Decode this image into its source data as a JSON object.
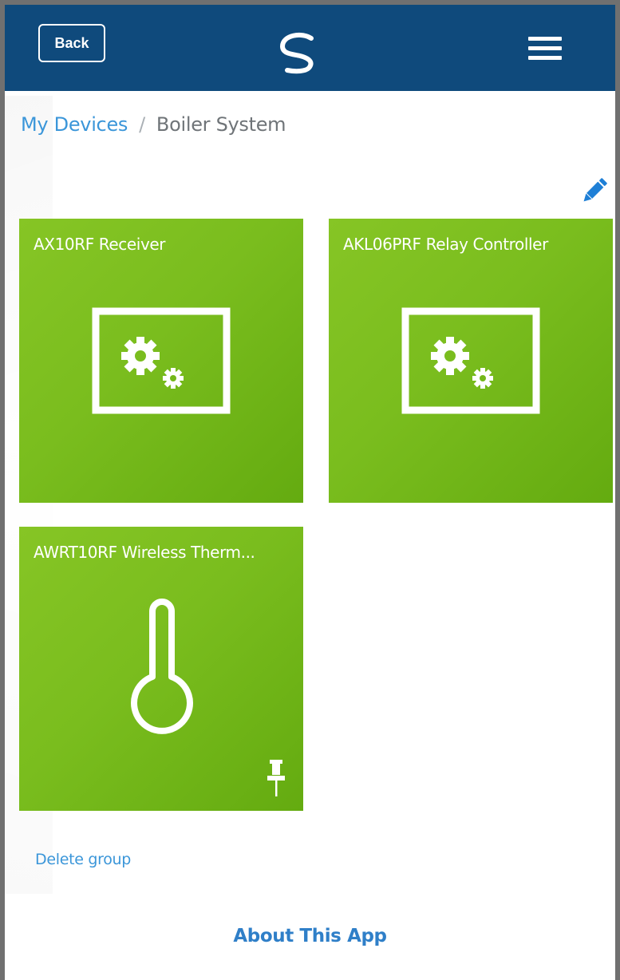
{
  "header": {
    "back_label": "Back",
    "logo_icon": "brand-s-logo",
    "menu_icon": "hamburger-menu-icon",
    "background_color": "#0f4a7c"
  },
  "breadcrumb": {
    "parent": "My Devices",
    "separator": "/",
    "current": "Boiler System"
  },
  "toolbar": {
    "edit_icon": "pencil-icon"
  },
  "devices": [
    {
      "title": "AX10RF Receiver",
      "icon": "controller-gears-icon",
      "pinned": false
    },
    {
      "title": "AKL06PRF Relay Controller",
      "icon": "controller-gears-icon",
      "pinned": false
    },
    {
      "title": "AWRT10RF Wireless Therm...",
      "icon": "thermometer-icon",
      "pinned": true
    }
  ],
  "tile_color": "#7abd1e",
  "link_color": "#3b96d9",
  "actions": {
    "delete_group": "Delete group"
  },
  "footer": {
    "about": "About This App"
  }
}
